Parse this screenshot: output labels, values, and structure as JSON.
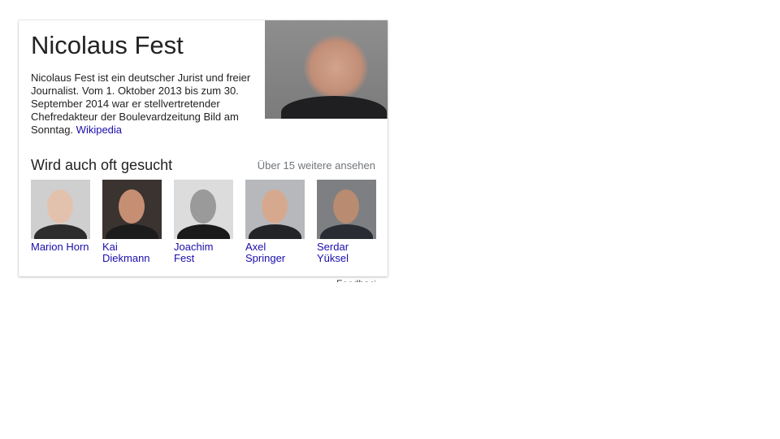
{
  "entity": {
    "title": "Nicolaus Fest",
    "description": "Nicolaus Fest ist ein deutscher Jurist und freier Journalist. Vom 1. Oktober 2013 bis zum 30. September 2014 war er stellvertretender Chefredakteur der Boulevardzeitung Bild am Sonntag.",
    "source_link": "Wikipedia"
  },
  "related": {
    "title": "Wird auch oft gesucht",
    "more_link": "Über 15 weitere ansehen",
    "people": [
      {
        "name": "Marion Horn",
        "bg": "#cfcfcf",
        "face": "#e3c2ad",
        "body": "#2d2d2d"
      },
      {
        "name": "Kai Diekmann",
        "bg": "#3b3330",
        "face": "#c68f73",
        "body": "#1c1c1c"
      },
      {
        "name": "Joachim Fest",
        "bg": "#dcdcdc",
        "face": "#9a9a9a",
        "body": "#1a1a1a"
      },
      {
        "name": "Axel Springer",
        "bg": "#b7b8bb",
        "face": "#d6a98f",
        "body": "#222428"
      },
      {
        "name": "Serdar Yüksel",
        "bg": "#7d7f82",
        "face": "#b98b70",
        "body": "#2a2c33"
      }
    ]
  },
  "footer": {
    "feedback": "Feedback"
  }
}
